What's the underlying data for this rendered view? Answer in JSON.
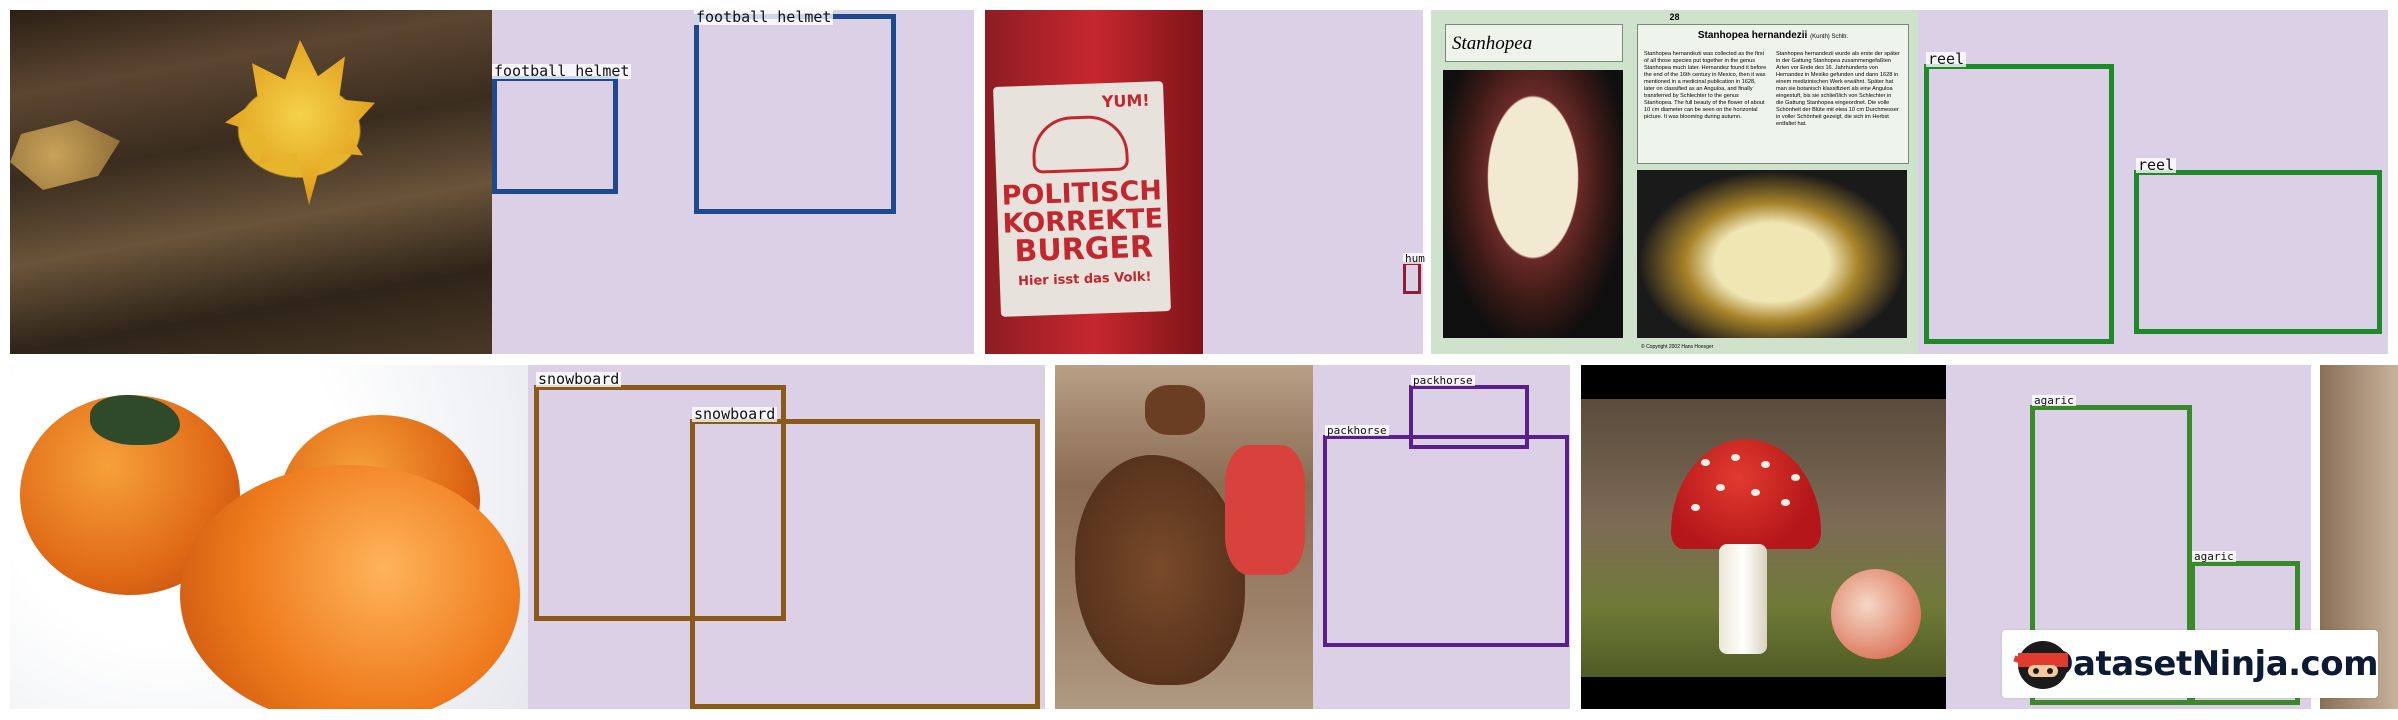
{
  "watermark": {
    "text": "DatasetNinja.com"
  },
  "row1": {
    "tile1": {
      "labels": [
        "football helmet",
        "football helmet"
      ],
      "box_color": "#1d4a8f"
    },
    "tile2": {
      "poster_lines": [
        "YUM!",
        "POLITISCH",
        "KORREKTE",
        "BURGER",
        "Hier isst das Volk!"
      ],
      "labels": [
        "hum"
      ],
      "box_color": "#8a1f35"
    },
    "tile3": {
      "page_number": "28",
      "species_title": "Stanhopea hernandezii",
      "heading": "Stanhopea hernandezii",
      "author": "(Kunth) Schltr.",
      "text_en": "Stanhopea hernandezii was collected as the first of all those species put together in the genus Stanhopea much later. Hernandez found it before the end of the 16th century in Mexico, then it was mentioned in a medicinal publication in 1628, later on classified as an Anguloa, and finally transferred by Schlechter to the genus Stanhopea. The full beauty of the flower of about 10 cm diameter can be seen on the horizontal picture. It was blooming during autumn.",
      "text_de": "Stanhopea hernandezii wurde als erste der später in der Gattung Stanhopea zusammengefaßten Arten vor Ende des 16. Jahrhunderts von Hernandez in Mexiko gefunden und dann 1628 in einem medizinischen Werk erwähnt. Später hat man sie botanisch klassifiziert als eine Anguloa eingestuft, bis sie schließlich von Schlechter in die Gattung Stanhopea eingeordnet. Die volle Schönheit der Blüte mit etwa 10 cm Durchmesser in voller Schönheit gezeigt, die sich im Herbst entfaltet hat.",
      "copyright": "© Copyright 2002 Hans Hoesger",
      "labels": [
        "reel",
        "reel"
      ],
      "box_color": "#1f8a2a"
    }
  },
  "row2": {
    "tile1": {
      "labels": [
        "snowboard",
        "snowboard"
      ],
      "box_color": "#8a5a1a"
    },
    "tile2": {
      "labels": [
        "packhorse",
        "packhorse"
      ],
      "box_color": "#5a1f8a"
    },
    "tile3": {
      "labels": [
        "agaric",
        "agaric"
      ],
      "box_color": "#3a8a2a"
    }
  }
}
